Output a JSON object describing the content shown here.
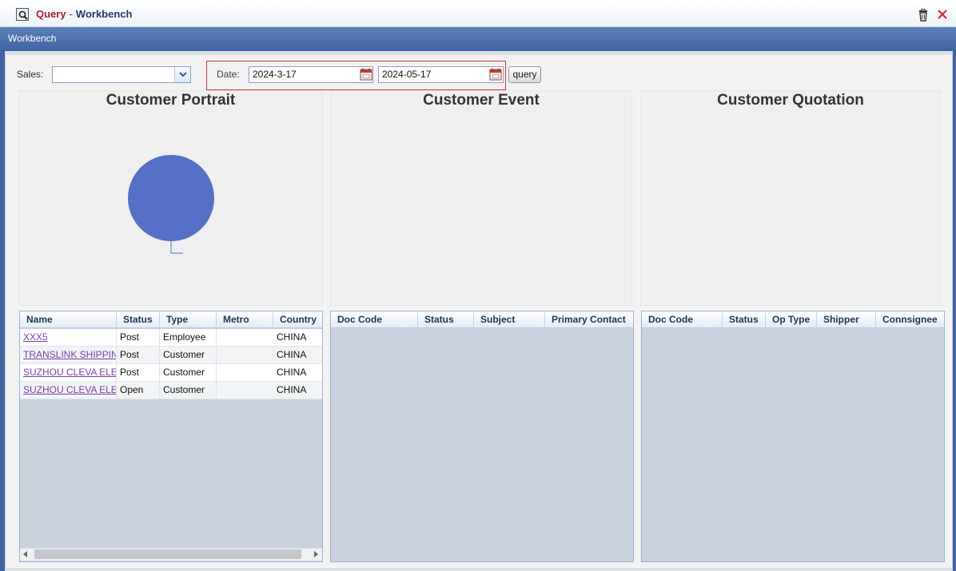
{
  "window": {
    "title_query": "Query",
    "title_sep": "-",
    "title_workbench": "Workbench"
  },
  "header": {
    "band_label": "Workbench"
  },
  "filters": {
    "sales_label": "Sales:",
    "sales_value": "",
    "date_label": "Date:",
    "date_from": "2024-3-17",
    "date_to": "2024-05-17",
    "query_label": "query"
  },
  "charts": [
    {
      "title": "Customer Portrait"
    },
    {
      "title": "Customer Event"
    },
    {
      "title": "Customer Quotation"
    }
  ],
  "chart_data": {
    "type": "pie",
    "title": "Customer Portrait",
    "categories": [
      ""
    ],
    "values": [
      100
    ],
    "colors": [
      "#5470c6"
    ],
    "legend": "none"
  },
  "portrait_grid": {
    "columns": [
      "Name",
      "Status",
      "Type",
      "Metro",
      "Country"
    ],
    "rows": [
      [
        "XXX5",
        "Post",
        "Employee",
        "",
        "CHINA"
      ],
      [
        "TRANSLINK SHIPPIN",
        "Post",
        "Customer",
        "",
        "CHINA"
      ],
      [
        "SUZHOU CLEVA ELE",
        "Post",
        "Customer",
        "",
        "CHINA"
      ],
      [
        "SUZHOU CLEVA ELE",
        "Open",
        "Customer",
        "",
        "CHINA"
      ]
    ]
  },
  "event_grid": {
    "columns": [
      "Doc Code",
      "Status",
      "Subject",
      "Primary Contact"
    ]
  },
  "quotation_grid": {
    "columns": [
      "Doc Code",
      "Status",
      "Op Type",
      "Shipper",
      "Connsignee"
    ]
  },
  "colors": {
    "accent": "#3f64a1",
    "title_red": "#b01d2f",
    "link": "#7a3fb0",
    "pie": "#5470c6"
  }
}
